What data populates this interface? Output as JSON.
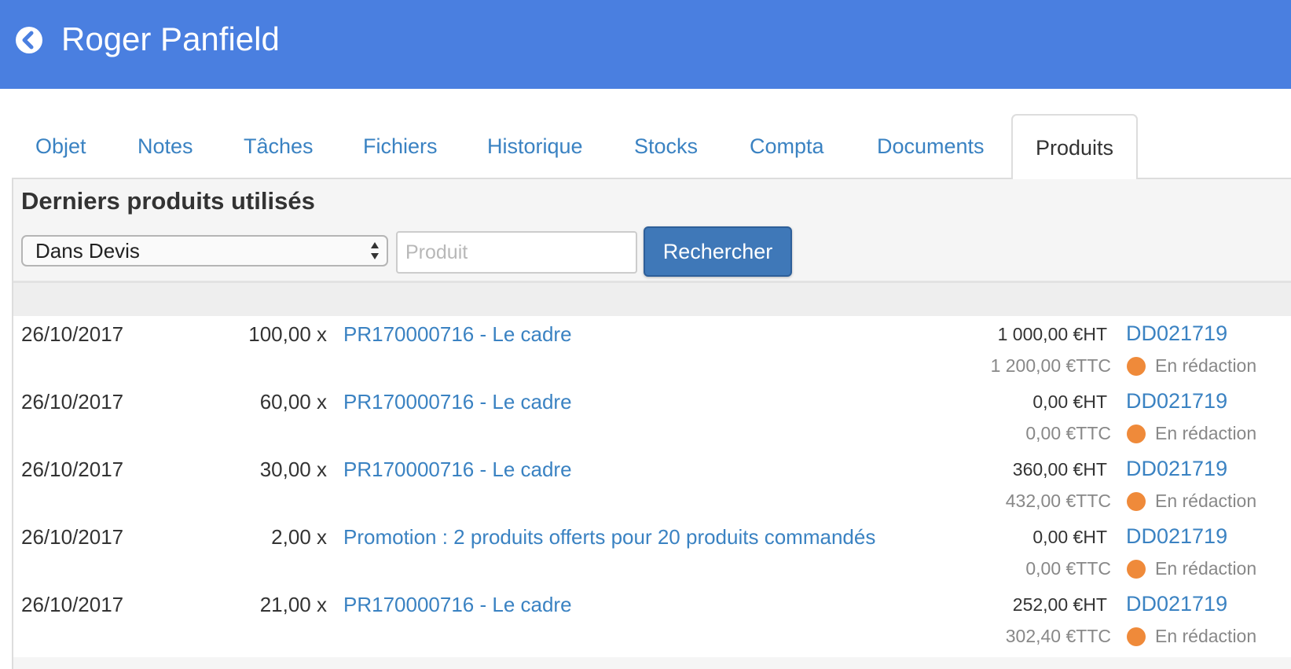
{
  "header": {
    "title": "Roger Panfield",
    "back_icon": "chevron-left-circle-icon",
    "background": "#4a7fe0"
  },
  "tabs": [
    {
      "label": "Objet",
      "active": false
    },
    {
      "label": "Notes",
      "active": false
    },
    {
      "label": "Tâches",
      "active": false
    },
    {
      "label": "Fichiers",
      "active": false
    },
    {
      "label": "Historique",
      "active": false
    },
    {
      "label": "Stocks",
      "active": false
    },
    {
      "label": "Compta",
      "active": false
    },
    {
      "label": "Documents",
      "active": false
    },
    {
      "label": "Produits",
      "active": true
    }
  ],
  "panel": {
    "title": "Derniers produits utilisés",
    "filter_select": {
      "value": "Dans Devis"
    },
    "search": {
      "placeholder": "Produit",
      "value": ""
    },
    "search_button_label": "Rechercher"
  },
  "rows": [
    {
      "date": "26/10/2017",
      "qty": "100,00 x",
      "product": "PR170000716 - Le cadre",
      "ht": "1 000,00 €HT",
      "ttc": "1 200,00 €TTC",
      "doc": "DD021719",
      "status": "En rédaction"
    },
    {
      "date": "26/10/2017",
      "qty": "60,00 x",
      "product": "PR170000716 - Le cadre",
      "ht": "0,00 €HT",
      "ttc": "0,00 €TTC",
      "doc": "DD021719",
      "status": "En rédaction"
    },
    {
      "date": "26/10/2017",
      "qty": "30,00 x",
      "product": "PR170000716 - Le cadre",
      "ht": "360,00 €HT",
      "ttc": "432,00 €TTC",
      "doc": "DD021719",
      "status": "En rédaction"
    },
    {
      "date": "26/10/2017",
      "qty": "2,00 x",
      "product": "Promotion : 2 produits offerts pour 20 produits commandés",
      "ht": "0,00 €HT",
      "ttc": "0,00 €TTC",
      "doc": "DD021719",
      "status": "En rédaction"
    },
    {
      "date": "26/10/2017",
      "qty": "21,00 x",
      "product": "PR170000716 - Le cadre",
      "ht": "252,00 €HT",
      "ttc": "302,40 €TTC",
      "doc": "DD021719",
      "status": "En rédaction"
    }
  ],
  "colors": {
    "link": "#3a82c2",
    "status_draft": "#ef8a3a",
    "button": "#3f78b8"
  }
}
